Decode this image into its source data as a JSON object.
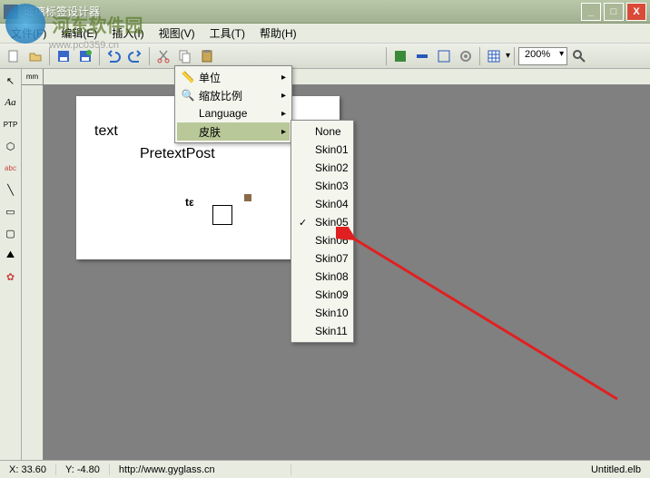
{
  "window": {
    "title": "玻璃标签设计器"
  },
  "watermark": {
    "text": "河东软件园",
    "sub": "www.pc0359.cn"
  },
  "menu": {
    "file": "文件(F)",
    "edit": "编辑(E)",
    "insert": "插入(I)",
    "view": "视图(V)",
    "tools": "工具(T)",
    "help": "帮助(H)"
  },
  "toolbar": {
    "zoom": "200%"
  },
  "ruler": {
    "corner": "mm"
  },
  "canvas": {
    "text1": "text",
    "text2": "PretextPost",
    "text3": "tε"
  },
  "viewmenu": {
    "unit": "单位",
    "scale": "缩放比例",
    "language": "Language",
    "skin": "皮肤"
  },
  "skins": [
    "None",
    "Skin01",
    "Skin02",
    "Skin03",
    "Skin04",
    "Skin05",
    "Skin06",
    "Skin07",
    "Skin08",
    "Skin09",
    "Skin10",
    "Skin11"
  ],
  "skin_checked": 5,
  "status": {
    "x": "X: 33.60",
    "y": "Y: -4.80",
    "url": "http://www.gyglass.cn",
    "file": "Untitled.elb"
  }
}
